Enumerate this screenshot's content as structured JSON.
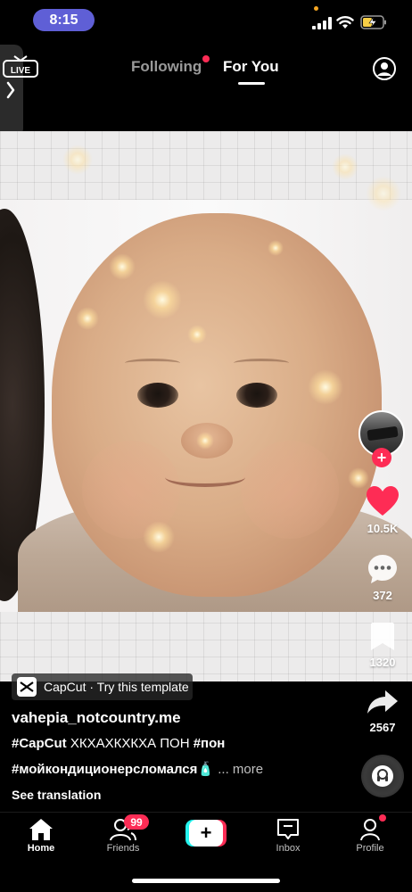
{
  "status_bar": {
    "time": "8:15",
    "icons": [
      "signal-icon",
      "wifi-icon",
      "battery-charging-icon"
    ]
  },
  "top_nav": {
    "live_icon": "live-tv-icon",
    "live_label": "LIVE",
    "tabs": [
      {
        "label": "Following",
        "active": false,
        "has_dot": true
      },
      {
        "label": "For You",
        "active": true
      }
    ],
    "search_icon": "person-search-icon"
  },
  "rail": {
    "avatar_icon": "creator-avatar",
    "like_count": "10.5K",
    "comment_count": "372",
    "bookmark_count": "1320",
    "share_count": "2567",
    "like_color": "#fe2c55"
  },
  "caption": {
    "capcut_label": "CapCut · Try this template",
    "username": "vahepia_notcountry.me",
    "line1_tag": "#CapCut",
    "line1_text": " ХКХАХКХКХА ПОН ",
    "line1_tag2": "#пон",
    "line2_tag": "#мойкондиционерсломался",
    "line2_emoji": "🧴",
    "more_label": "... more",
    "see_translation": "See translation"
  },
  "bottom_nav": {
    "items": [
      {
        "label": "Home",
        "icon": "home-icon",
        "active": true
      },
      {
        "label": "Friends",
        "icon": "friends-icon",
        "badge": "99"
      },
      {
        "label": "",
        "icon": "create-plus-icon"
      },
      {
        "label": "Inbox",
        "icon": "inbox-icon"
      },
      {
        "label": "Profile",
        "icon": "profile-icon",
        "has_dot": true
      }
    ],
    "create_symbol": "+"
  },
  "colors": {
    "accent_red": "#fe2c55",
    "accent_cyan": "#25f4ee",
    "time_pill": "#5f5fd6"
  }
}
